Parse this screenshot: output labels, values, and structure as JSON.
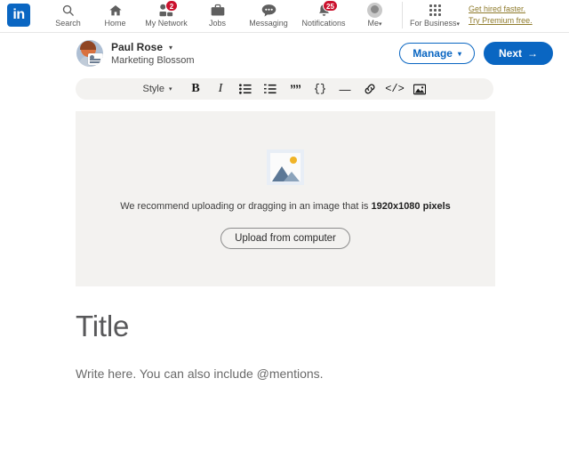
{
  "nav": {
    "logo_text": "in",
    "items": [
      {
        "label": "Search",
        "icon": "search-icon",
        "badge": null
      },
      {
        "label": "Home",
        "icon": "home-icon",
        "badge": null
      },
      {
        "label": "My Network",
        "icon": "my-network-icon",
        "badge": "2"
      },
      {
        "label": "Jobs",
        "icon": "jobs-icon",
        "badge": null
      },
      {
        "label": "Messaging",
        "icon": "messaging-icon",
        "badge": null
      },
      {
        "label": "Notifications",
        "icon": "notifications-icon",
        "badge": "25"
      }
    ],
    "me": {
      "label": "Me",
      "caret": "▾",
      "icon": "avatar-icon"
    },
    "for_business": {
      "label": "For Business",
      "caret": "▾",
      "icon": "app-grid-icon"
    },
    "promo": [
      {
        "label": "Get hired faster."
      },
      {
        "label": "Try Premium free."
      }
    ],
    "promo_color": "#8f7b2c",
    "brand_color": "#0a66c2",
    "badge_color": "#cb112d"
  },
  "author": {
    "name": "Paul Rose",
    "name_caret": "▾",
    "subtitle": "Marketing Blossom",
    "manage_label": "Manage",
    "manage_caret": "▾",
    "next_label": "Next",
    "next_arrow": "→"
  },
  "toolbar": {
    "style_label": "Style",
    "style_caret": "▾",
    "items": [
      {
        "name": "bold-icon",
        "glyph": "B"
      },
      {
        "name": "italic-icon",
        "glyph": "I"
      },
      {
        "name": "bulleted-list-icon",
        "glyph": ""
      },
      {
        "name": "numbered-list-icon",
        "glyph": ""
      },
      {
        "name": "quote-icon",
        "glyph": "””"
      },
      {
        "name": "code-block-icon",
        "glyph": "{}"
      },
      {
        "name": "divider-icon",
        "glyph": "—"
      },
      {
        "name": "link-icon",
        "glyph": ""
      },
      {
        "name": "embed-icon",
        "glyph": "</>"
      },
      {
        "name": "image-icon",
        "glyph": ""
      }
    ]
  },
  "upload": {
    "hint_prefix": "We recommend uploading or dragging in an image that is ",
    "hint_dimensions": "1920x1080 pixels",
    "button_label": "Upload from computer",
    "background_color": "#f3f2f0"
  },
  "editor": {
    "title_placeholder": "Title",
    "body_placeholder": "Write here. You can also include @mentions."
  }
}
